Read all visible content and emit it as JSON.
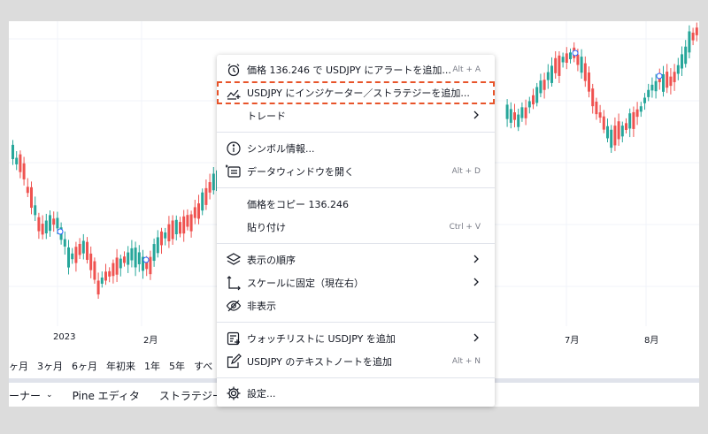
{
  "chart": {
    "x_axis_labels": [
      "2023",
      "2月",
      "7月",
      "8月"
    ],
    "colors": {
      "up": "#26a69a",
      "down": "#ef5350",
      "grid": "#f0f3fa"
    }
  },
  "timeframes": [
    "ヶ月",
    "3ヶ月",
    "6ヶ月",
    "年初来",
    "1年",
    "5年",
    "すべ"
  ],
  "bottom_bar": {
    "items": [
      {
        "label": "ーナー",
        "chevron": "⌄"
      },
      {
        "label": "Pine エディタ"
      },
      {
        "label": "ストラテジー"
      }
    ]
  },
  "context_menu": {
    "items": [
      {
        "icon": "alarm-add-icon",
        "label": "価格 136.246 で USDJPY にアラートを追加...",
        "shortcut": "Alt + A"
      },
      {
        "icon": "indicator-add-icon",
        "label": "USDJPY にインジケーター／ストラテジーを追加...",
        "highlighted": true
      },
      {
        "label": "トレード",
        "submenu": true
      },
      {
        "icon": "info-icon",
        "label": "シンボル情報..."
      },
      {
        "icon": "data-window-icon",
        "label": "データウィンドウを開く",
        "shortcut": "Alt + D"
      },
      {
        "label": "価格をコピー 136.246"
      },
      {
        "label": "貼り付け",
        "shortcut": "Ctrl + V"
      },
      {
        "icon": "layers-icon",
        "label": "表示の順序",
        "submenu": true
      },
      {
        "icon": "scale-pin-icon",
        "label": "スケールに固定（現在右）",
        "submenu": true
      },
      {
        "icon": "eye-off-icon",
        "label": "非表示"
      },
      {
        "icon": "watchlist-add-icon",
        "label": "ウォッチリストに USDJPY を追加",
        "submenu": true
      },
      {
        "icon": "note-edit-icon",
        "label": "USDJPY のテキストノートを追加",
        "shortcut": "Alt + N"
      },
      {
        "icon": "gear-icon",
        "label": "設定..."
      }
    ],
    "highlight_color": "#e8542a"
  }
}
